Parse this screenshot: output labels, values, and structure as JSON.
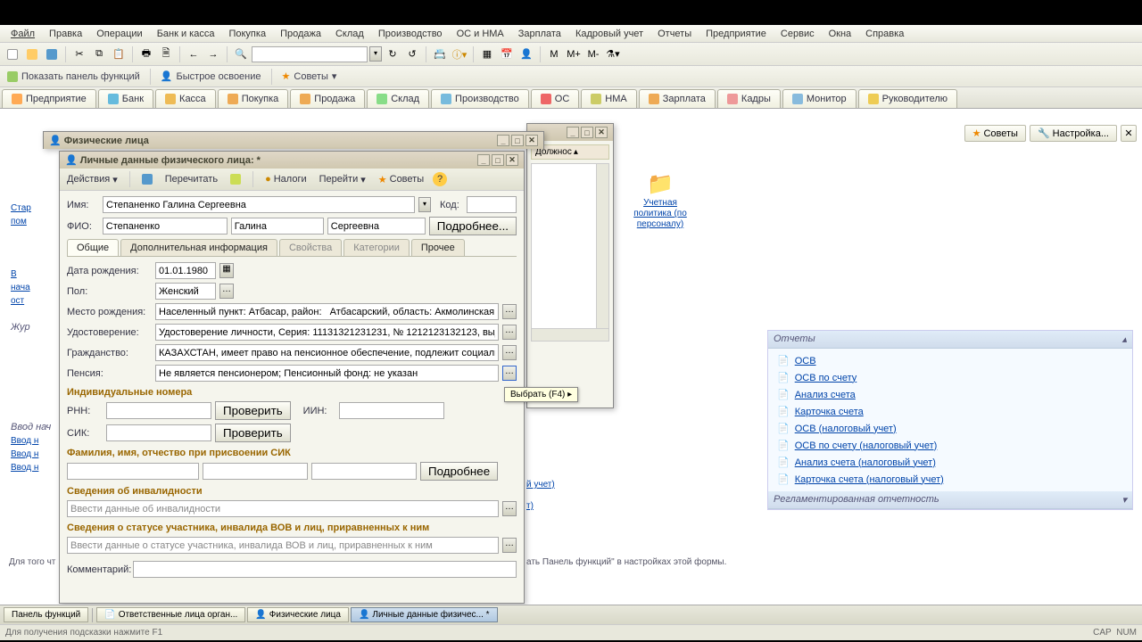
{
  "menu": {
    "file": "Файл",
    "edit": "Правка",
    "ops": "Операции",
    "bank": "Банк и касса",
    "buy": "Покупка",
    "sale": "Продажа",
    "stock": "Склад",
    "prod": "Производство",
    "os": "ОС и НМА",
    "salary": "Зарплата",
    "hr": "Кадровый учет",
    "reports": "Отчеты",
    "ent": "Предприятие",
    "service": "Сервис",
    "windows": "Окна",
    "help": "Справка"
  },
  "tb2": {
    "panel": "Показать панель функций",
    "fast": "Быстрое освоение",
    "advice": "Советы"
  },
  "nav": {
    "ent": "Предприятие",
    "bank": "Банк",
    "kassa": "Касса",
    "buy": "Покупка",
    "sale": "Продажа",
    "stock": "Склад",
    "prod": "Производство",
    "os": "ОС",
    "nma": "НМА",
    "salary": "Зарплата",
    "hr": "Кадры",
    "monitor": "Монитор",
    "boss": "Руководителю"
  },
  "right": {
    "advice": "Советы",
    "settings": "Настройка...",
    "close": "✕"
  },
  "org": {
    "label": "Учетная политика (по персоналу)"
  },
  "reports": {
    "title": "Отчеты",
    "title2": "Регламентированная отчетность",
    "items": [
      "ОСВ",
      "ОСВ по счету",
      "Анализ счета",
      "Карточка счета",
      "ОСВ (налоговый учет)",
      "ОСВ по счету (налоговый учет)",
      "Анализ счета (налоговый учет)",
      "Карточка счета (налоговый учет)"
    ]
  },
  "winback": {
    "tab": "Должнос"
  },
  "winmid": {
    "title": "Физические лица"
  },
  "main": {
    "title": "Личные данные физического лица:  *",
    "actions": "Действия",
    "reread": "Перечитать",
    "taxes": "Налоги",
    "go": "Перейти",
    "advice": "Советы",
    "name_lbl": "Имя:",
    "name": "Степаненко Галина Сергеевна",
    "code_lbl": "Код:",
    "fio_lbl": "ФИО:",
    "f": "Степаненко",
    "i": "Галина",
    "o": "Сергеевна",
    "more": "Подробнее...",
    "tabs": {
      "common": "Общие",
      "addinfo": "Дополнительная информация",
      "props": "Свойства",
      "cats": "Категории",
      "other": "Прочее"
    },
    "birth_lbl": "Дата рождения:",
    "birth": "01.01.1980",
    "sex_lbl": "Пол:",
    "sex": "Женский",
    "place_lbl": "Место рождения:",
    "place": "Населенный пункт: Атбасар, район:   Атбасарский, область: Акмолинская, стр…",
    "doc_lbl": "Удостоверение:",
    "doc": "Удостоверение личности, Серия: 11131321231231, № 1212123132123, выдан: С…",
    "citizen_lbl": "Гражданство:",
    "citizen": "КАЗАХСТАН, имеет право на пенсионное обеспечение, подлежит социальном…",
    "pension_lbl": "Пенсия:",
    "pension": "Не является пенсионером; Пенсионный фонд: не указан",
    "sec_ind": "Индивидуальные номера",
    "rnn_lbl": "РНН:",
    "check": "Проверить",
    "iin_lbl": "ИИН:",
    "sik_lbl": "СИК:",
    "sec_sik": "Фамилия, имя, отчество при присвоении СИК",
    "more2": "Подробнее",
    "sec_dis": "Сведения об инвалидности",
    "dis_ph": "Ввести данные об инвалидности",
    "sec_vov": "Сведения о статусе участника, инвалида ВОВ и лиц, приравненных к ним",
    "vov_ph": "Ввести данные о статусе участника, инвалида ВОВ и лиц, приравненных к ним",
    "comment_lbl": "Комментарий:"
  },
  "tooltip": "Выбрать (F4)",
  "hint": "ать Панель функций\" в настройках этой формы.",
  "hint2": "Для того чт",
  "task": {
    "panel": "Панель функций",
    "resp": "Ответственные лица орган...",
    "fiz": "Физические лица",
    "pers": "Личные данные физичес... *"
  },
  "status": {
    "hint": "Для получения подсказки нажмите F1",
    "cap": "CAP",
    "num": "NUM"
  },
  "left": {
    "a": "Стар",
    "b": "пом",
    "c": "В",
    "d": "нача",
    "e": "ост",
    "f": "Жур",
    "g": "Ввод нач",
    "h": "Ввод н",
    "i": "Ввод н",
    "j": "Ввод н"
  }
}
